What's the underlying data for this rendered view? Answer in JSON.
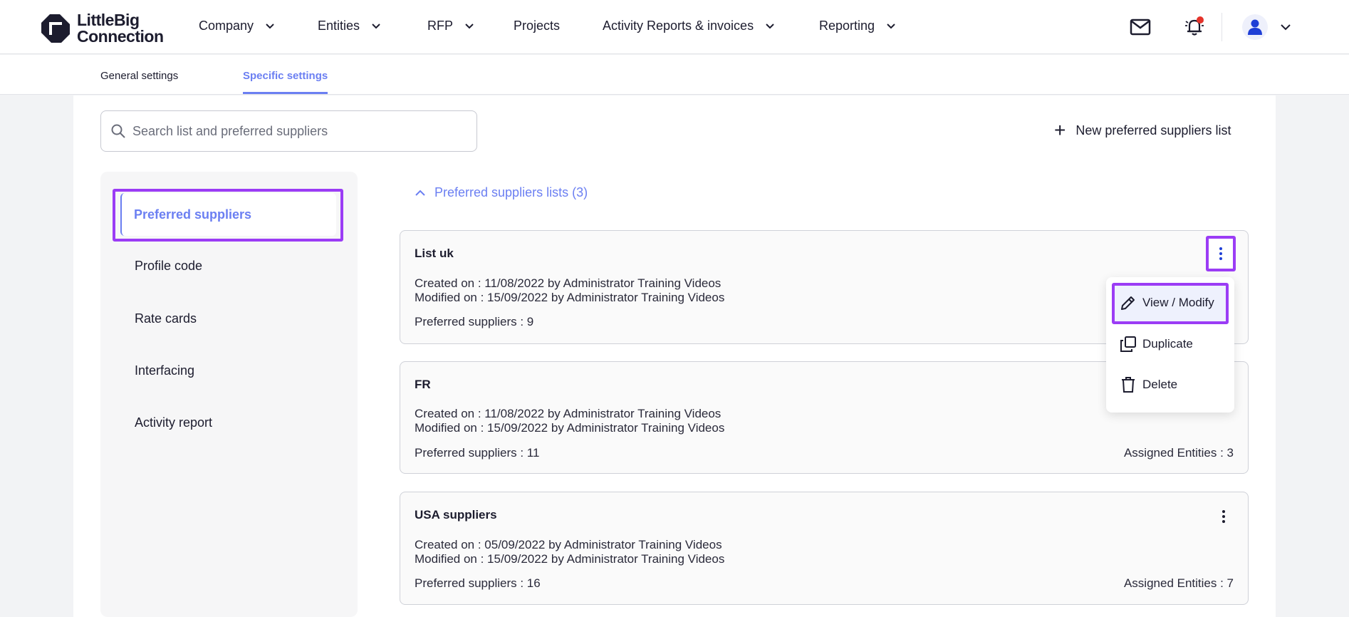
{
  "app": {
    "logo_line1": "LittleBig",
    "logo_line2": "Connection"
  },
  "nav": {
    "items": [
      {
        "label": "Company",
        "has_dropdown": true
      },
      {
        "label": "Entities",
        "has_dropdown": true
      },
      {
        "label": "RFP",
        "has_dropdown": true
      },
      {
        "label": "Projects",
        "has_dropdown": false
      },
      {
        "label": "Activity Reports & invoices",
        "has_dropdown": true
      },
      {
        "label": "Reporting",
        "has_dropdown": true
      }
    ],
    "icons": [
      "mail-icon",
      "bell-icon",
      "user-icon",
      "chevron-down-icon"
    ]
  },
  "tabs": [
    {
      "label": "General settings",
      "active": false
    },
    {
      "label": "Specific settings",
      "active": true
    }
  ],
  "search": {
    "placeholder": "Search list and preferred suppliers",
    "value": ""
  },
  "new_list_label": "New preferred suppliers list",
  "sidebar": {
    "items": [
      {
        "label": "Preferred suppliers",
        "active": true
      },
      {
        "label": "Profile code",
        "active": false
      },
      {
        "label": "Rate cards",
        "active": false
      },
      {
        "label": "Interfacing",
        "active": false
      },
      {
        "label": "Activity report",
        "active": false
      }
    ]
  },
  "lists_header": "Preferred suppliers lists (3)",
  "lists": [
    {
      "name": "List uk",
      "created": "Created on : 11/08/2022 by Administrator Training Videos",
      "modified": "Modified on : 15/09/2022 by Administrator Training Videos",
      "suppliers": "Preferred suppliers : 9",
      "assigned": ""
    },
    {
      "name": "FR",
      "created": "Created on : 11/08/2022 by Administrator Training Videos",
      "modified": "Modified on : 15/09/2022 by Administrator Training Videos",
      "suppliers": "Preferred suppliers : 11",
      "assigned": "Assigned Entities : 3"
    },
    {
      "name": "USA suppliers",
      "created": "Created on : 05/09/2022 by Administrator Training Videos",
      "modified": "Modified on : 15/09/2022 by Administrator Training Videos",
      "suppliers": "Preferred suppliers : 16",
      "assigned": "Assigned Entities : 7"
    }
  ],
  "menu": {
    "items": [
      {
        "label": "View / Modify",
        "icon": "pencil-icon"
      },
      {
        "label": "Duplicate",
        "icon": "duplicate-icon"
      },
      {
        "label": "Delete",
        "icon": "trash-icon"
      }
    ]
  },
  "colors": {
    "accent": "#6b7ff2",
    "highlight": "#9b3cf5",
    "notification": "#e5332a",
    "user": "#1f3fd6"
  }
}
